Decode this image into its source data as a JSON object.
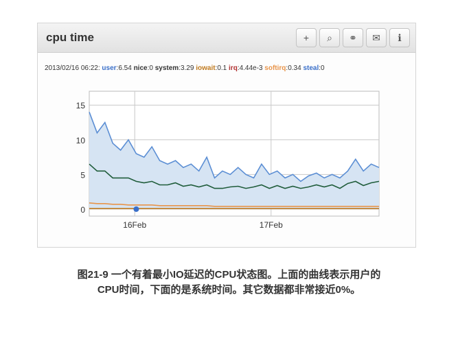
{
  "widget": {
    "title": "cpu time",
    "buttons": [
      {
        "name": "plus-icon",
        "glyph": "+"
      },
      {
        "name": "zoom-icon",
        "glyph": "⌕"
      },
      {
        "name": "link-icon",
        "glyph": "⚭"
      },
      {
        "name": "mail-icon",
        "glyph": "✉"
      },
      {
        "name": "info-icon",
        "glyph": "ℹ"
      }
    ]
  },
  "legend": {
    "timestamp": "2013/02/16 06:22:",
    "items": [
      {
        "label": "user",
        "value": "6.54",
        "color": "#3a6fc9"
      },
      {
        "label": "nice",
        "value": "0",
        "color": "#333333"
      },
      {
        "label": "system",
        "value": "3.29",
        "color": "#333333"
      },
      {
        "label": "iowait",
        "value": "0.1",
        "color": "#c07a1f"
      },
      {
        "label": "irq",
        "value": "4.44e-3",
        "color": "#b03030"
      },
      {
        "label": "softirq",
        "value": "0.34",
        "color": "#e8944a"
      },
      {
        "label": "steal",
        "value": "0",
        "color": "#3a6fc9"
      }
    ]
  },
  "chart_data": {
    "type": "line",
    "x_range": [
      "2013-02-15T16:00",
      "2013-02-17T19:00"
    ],
    "x_ticks": [
      {
        "label": "16Feb",
        "x": "2013-02-16T00:00"
      },
      {
        "label": "17Feb",
        "x": "2013-02-17T00:00"
      }
    ],
    "ylim": [
      -1,
      17
    ],
    "y_ticks": [
      0,
      5,
      10,
      15
    ],
    "grid": true,
    "series": [
      {
        "name": "user",
        "color": "#5b8ed4",
        "fill": "#d6e4f3",
        "values": [
          14,
          11,
          12.5,
          9.5,
          8.5,
          10,
          8,
          7.5,
          9,
          7,
          6.5,
          7,
          6,
          6.5,
          5.5,
          7.5,
          4.5,
          5.5,
          5,
          6,
          5,
          4.5,
          6.5,
          5,
          5.5,
          4.5,
          5,
          4,
          4.8,
          5.2,
          4.5,
          5,
          4.5,
          5.5,
          7.2,
          5.5,
          6.5,
          6
        ]
      },
      {
        "name": "system",
        "color": "#1f5c3a",
        "values": [
          6.5,
          5.5,
          5.5,
          4.5,
          4.5,
          4.5,
          4,
          3.8,
          4,
          3.5,
          3.5,
          3.8,
          3.3,
          3.5,
          3.2,
          3.5,
          3,
          3,
          3.2,
          3.3,
          3,
          3.2,
          3.5,
          3,
          3.4,
          3,
          3.3,
          3,
          3.2,
          3.5,
          3.2,
          3.5,
          3,
          3.7,
          4,
          3.4,
          3.8,
          4
        ]
      },
      {
        "name": "softirq",
        "color": "#e8944a",
        "values": [
          0.9,
          0.8,
          0.8,
          0.7,
          0.7,
          0.6,
          0.6,
          0.6,
          0.6,
          0.5,
          0.5,
          0.5,
          0.5,
          0.5,
          0.5,
          0.5,
          0.4,
          0.4,
          0.4,
          0.4,
          0.4,
          0.4,
          0.4,
          0.4,
          0.4,
          0.4,
          0.4,
          0.4,
          0.4,
          0.4,
          0.4,
          0.4,
          0.4,
          0.4,
          0.4,
          0.4,
          0.4,
          0.4
        ]
      },
      {
        "name": "iowait",
        "color": "#c07a1f",
        "values": [
          0.1,
          0.1,
          0.1,
          0.1,
          0.1,
          0.1,
          0.1,
          0.1,
          0.1,
          0.1,
          0.1,
          0.1,
          0.1,
          0.1,
          0.1,
          0.1,
          0.1,
          0.1,
          0.1,
          0.1,
          0.1,
          0.1,
          0.1,
          0.1,
          0.1,
          0.1,
          0.1,
          0.1,
          0.1,
          0.1,
          0.1,
          0.1,
          0.1,
          0.1,
          0.1,
          0.1,
          0.1,
          0.1
        ]
      }
    ],
    "marker": {
      "x_index": 6,
      "y": 0,
      "color": "#3a6fc9"
    }
  },
  "caption": {
    "line1": "图21-9 一个有着最小IO延迟的CPU状态图。上面的曲线表示用户的",
    "line2": "CPU时间，下面的是系统时间。其它数据都非常接近0%。"
  }
}
